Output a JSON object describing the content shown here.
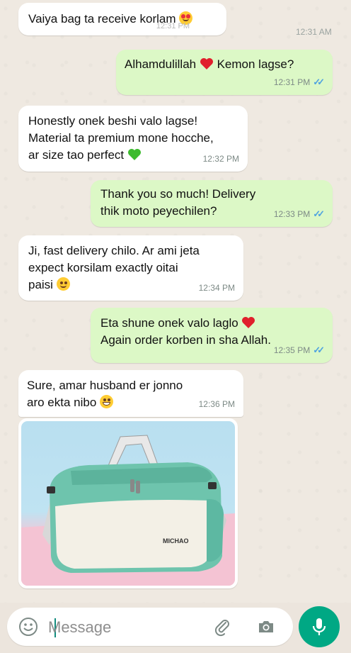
{
  "messages": [
    {
      "id": "m1",
      "dir": "in",
      "text": "Vaiya bag ta receive korlam",
      "emoji": "smiling-face-with-heart-eyes",
      "time": "12:31 PM",
      "time_outer": "12:31 AM"
    },
    {
      "id": "m2",
      "dir": "out",
      "text": "Alhamdulillah",
      "text_after": "Kemon lagse?",
      "emoji": "red-heart",
      "time": "12:31 PM",
      "status": "read"
    },
    {
      "id": "m3",
      "dir": "in",
      "lines": [
        "Honestly onek beshi valo lagse!",
        "Material ta premium mone hocche,",
        "ar size tao perfect"
      ],
      "emoji": "green-heart",
      "time": "12:32 PM"
    },
    {
      "id": "m4",
      "dir": "out",
      "lines": [
        "Thank you so much! Delivery",
        "thik moto peyechilen?"
      ],
      "time": "12:33 PM",
      "status": "read"
    },
    {
      "id": "m5",
      "dir": "in",
      "lines": [
        "Ji, fast delivery chilo. Ar ami jeta",
        "expect korsilam exactly oitai",
        "paisi"
      ],
      "emoji": "smiling-face",
      "time": "12:34 PM"
    },
    {
      "id": "m6",
      "dir": "out",
      "lines": [
        "Eta shune onek valo laglo",
        "Again order korben in sha Allah."
      ],
      "emoji": "red-heart",
      "time": "12:35 PM",
      "status": "read"
    },
    {
      "id": "m7",
      "dir": "in",
      "lines": [
        "Sure, amar husband er jonno",
        "aro ekta nibo"
      ],
      "emoji": "grinning-face",
      "time": "12:36 PM"
    }
  ],
  "photo": {
    "brand": "MICHAO",
    "subject": "mint green and cream duffel bag"
  },
  "input": {
    "placeholder": "Message"
  },
  "icons": {
    "emoji_button": "smiley-icon",
    "attach_button": "paperclip-icon",
    "camera_button": "camera-icon",
    "mic_button": "microphone-icon"
  },
  "colors": {
    "incoming": "#ffffff",
    "outgoing": "#dcf8c6",
    "read_ticks": "#4fa3e0",
    "mic": "#00a884"
  }
}
